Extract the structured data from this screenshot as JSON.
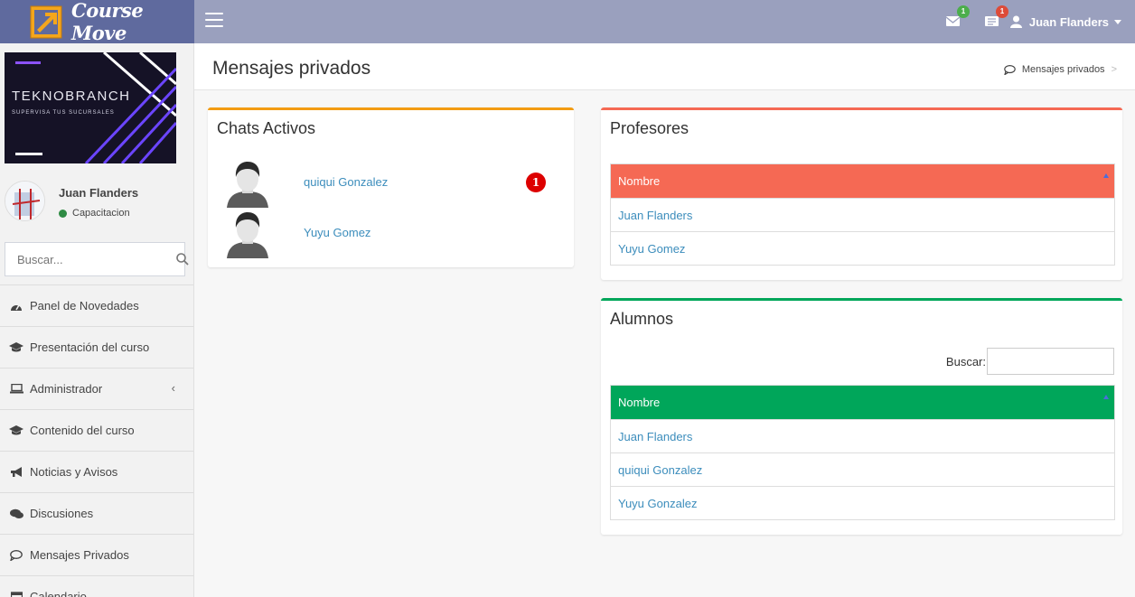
{
  "header": {
    "logo_text": "Course Move",
    "messages_badge": "1",
    "notifications_badge": "1",
    "user_name": "Juan Flanders"
  },
  "sidebar": {
    "banner_title": "TEKNOBRANCH",
    "banner_subtitle": "SUPERVISA TUS SUCURSALES",
    "user_name": "Juan Flanders",
    "user_status": "Capacitacion",
    "search_placeholder": "Buscar...",
    "items": [
      {
        "label": "Panel de Novedades",
        "icon": "dashboard-icon"
      },
      {
        "label": "Presentación del curso",
        "icon": "graduation-cap-icon"
      },
      {
        "label": "Administrador",
        "icon": "laptop-icon"
      },
      {
        "label": "Contenido del curso",
        "icon": "graduation-cap-icon"
      },
      {
        "label": "Noticias y Avisos",
        "icon": "bullhorn-icon"
      },
      {
        "label": "Discusiones",
        "icon": "comments-icon"
      },
      {
        "label": "Mensajes Privados",
        "icon": "comment-icon"
      },
      {
        "label": "Calendario",
        "icon": "calendar-icon"
      }
    ]
  },
  "content": {
    "page_title": "Mensajes privados",
    "breadcrumb": "Mensajes privados",
    "chats": {
      "title": "Chats Activos",
      "rows": [
        {
          "name": "quiqui Gonzalez",
          "unread": "1"
        },
        {
          "name": "Yuyu Gomez"
        }
      ]
    },
    "profesores": {
      "title": "Profesores",
      "column": "Nombre",
      "rows": [
        "Juan Flanders",
        "Yuyu Gomez"
      ]
    },
    "alumnos": {
      "title": "Alumnos",
      "search_label": "Buscar:",
      "column": "Nombre",
      "rows": [
        "Juan Flanders",
        "quiqui Gonzalez",
        "Yuyu Gonzalez"
      ]
    }
  },
  "colors": {
    "logo_bg": "#5f6a9e",
    "topbar_bg": "#9aa0be",
    "chats_border": "#f39c12",
    "profesores_accent": "#f56954",
    "alumnos_accent": "#00a65a",
    "link": "#3c8dbc"
  }
}
